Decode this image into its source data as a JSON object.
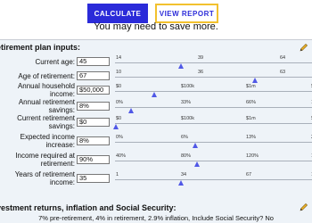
{
  "buttons": {
    "calculate": "CALCULATE",
    "view_report": "VIEW REPORT"
  },
  "save_note": "You may need to save more.",
  "inputs_section": {
    "title": "etirement plan inputs:",
    "rows": [
      {
        "label": [
          "Current age:"
        ],
        "value": "45",
        "ticks": [
          "14",
          "39",
          "64"
        ],
        "thumb_fraction": 0.34
      },
      {
        "label": [
          "Age of retirement:"
        ],
        "value": "67",
        "ticks": [
          "10",
          "36",
          "63"
        ],
        "thumb_fraction": 0.72
      },
      {
        "label": [
          "Annual household",
          "income:"
        ],
        "value": "$50,000",
        "ticks": [
          "$0",
          "$100k",
          "$1m",
          "$10"
        ],
        "thumb_fraction": 0.2
      },
      {
        "label": [
          "Annual retirement",
          "savings:"
        ],
        "value": "8%",
        "ticks": [
          "0%",
          "33%",
          "66%",
          "100"
        ],
        "thumb_fraction": 0.08
      },
      {
        "label": [
          "Current retirement",
          "savings:"
        ],
        "value": "$0",
        "ticks": [
          "$0",
          "$100k",
          "$1m",
          "$10"
        ],
        "thumb_fraction": 0.0
      },
      {
        "label": [
          "Expected income",
          "increase:"
        ],
        "value": "8%",
        "ticks": [
          "0%",
          "6%",
          "13%",
          "20"
        ],
        "thumb_fraction": 0.41
      },
      {
        "label": [
          "Income required at",
          "retirement:"
        ],
        "value": "90%",
        "ticks": [
          "40%",
          "80%",
          "120%",
          "160"
        ],
        "thumb_fraction": 0.42
      },
      {
        "label": [
          "Years of retirement",
          "income:"
        ],
        "value": "35",
        "ticks": [
          "1",
          "34",
          "67",
          "1"
        ],
        "thumb_fraction": 0.34
      }
    ]
  },
  "returns_section": {
    "title": "vestment returns, inflation and Social Security:",
    "summary": "7% pre-retirement, 4% in retirement, 2.9% inflation, Include Social Security? No"
  },
  "icons": {
    "edit": "pencil-icon",
    "thumb": "triangle-up-icon"
  },
  "colors": {
    "accent": "#2b2bd9",
    "highlight": "#f2c12e",
    "thumb": "#5058e6",
    "panel": "#eef3f8"
  }
}
